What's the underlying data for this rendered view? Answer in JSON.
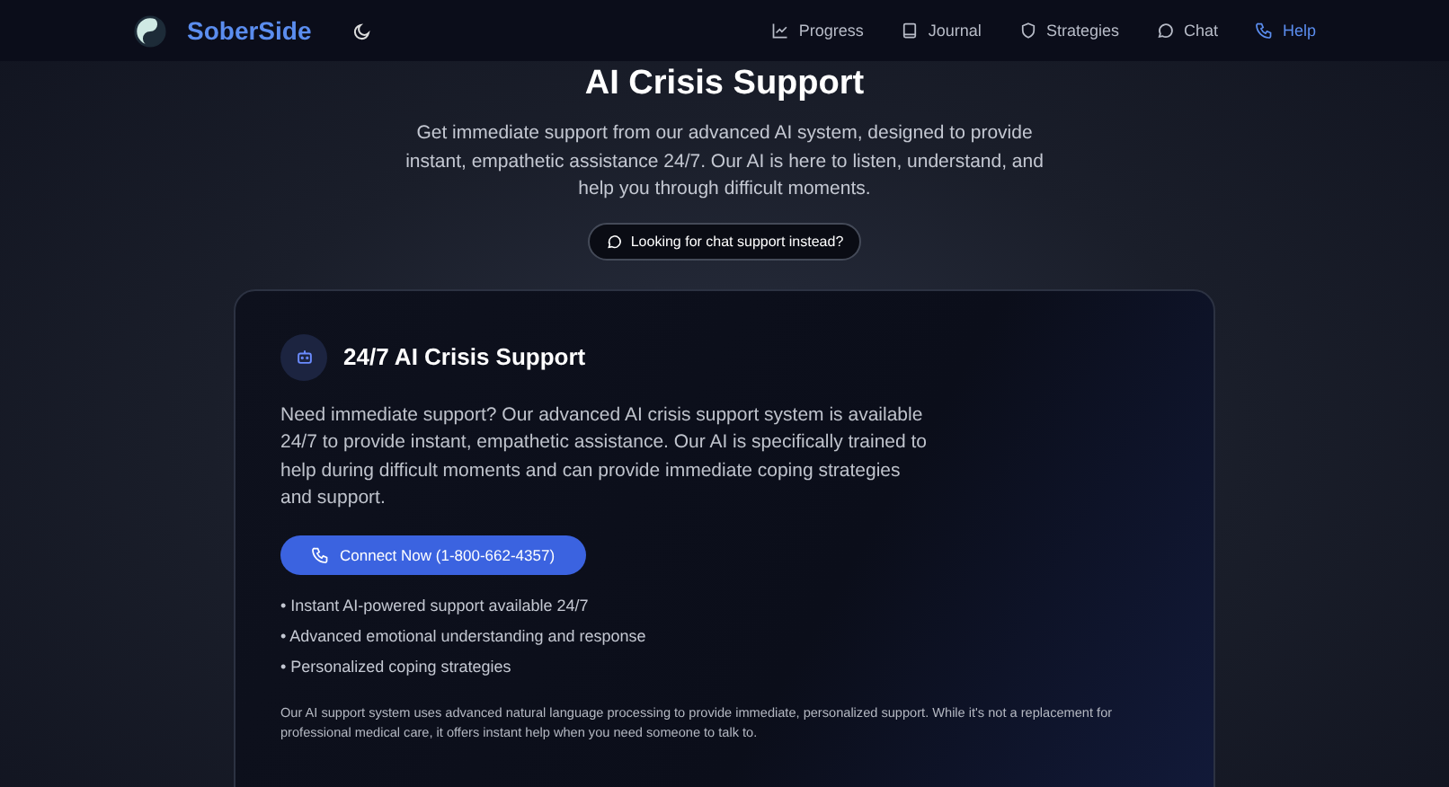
{
  "nav": {
    "brand": "SoberSide",
    "items": [
      {
        "label": "Progress",
        "selected": false
      },
      {
        "label": "Journal",
        "selected": false
      },
      {
        "label": "Strategies",
        "selected": false
      },
      {
        "label": "Chat",
        "selected": false
      },
      {
        "label": "Help",
        "selected": true
      }
    ]
  },
  "hero": {
    "title": "AI Crisis Support",
    "subtitle": "Get immediate support from our advanced AI system, designed to provide instant, empathetic assistance 24/7. Our AI is here to listen, understand, and help you through difficult moments.",
    "chat_link": "Looking for chat support instead?"
  },
  "card": {
    "title": "24/7 AI Crisis Support",
    "description": "Need immediate support? Our advanced AI crisis support system is available 24/7 to provide instant, empathetic assistance. Our AI is specifically trained to help during difficult moments and can provide immediate coping strategies and support.",
    "button": "Connect Now (1-800-662-4357)",
    "features": [
      "• Instant AI-powered support available 24/7",
      "• Advanced emotional understanding and response",
      "• Personalized coping strategies"
    ],
    "note": "Our AI support system uses advanced natural language processing to provide immediate, personalized support. While it's not a replacement for professional medical care, it offers instant help when you need someone to talk to."
  }
}
